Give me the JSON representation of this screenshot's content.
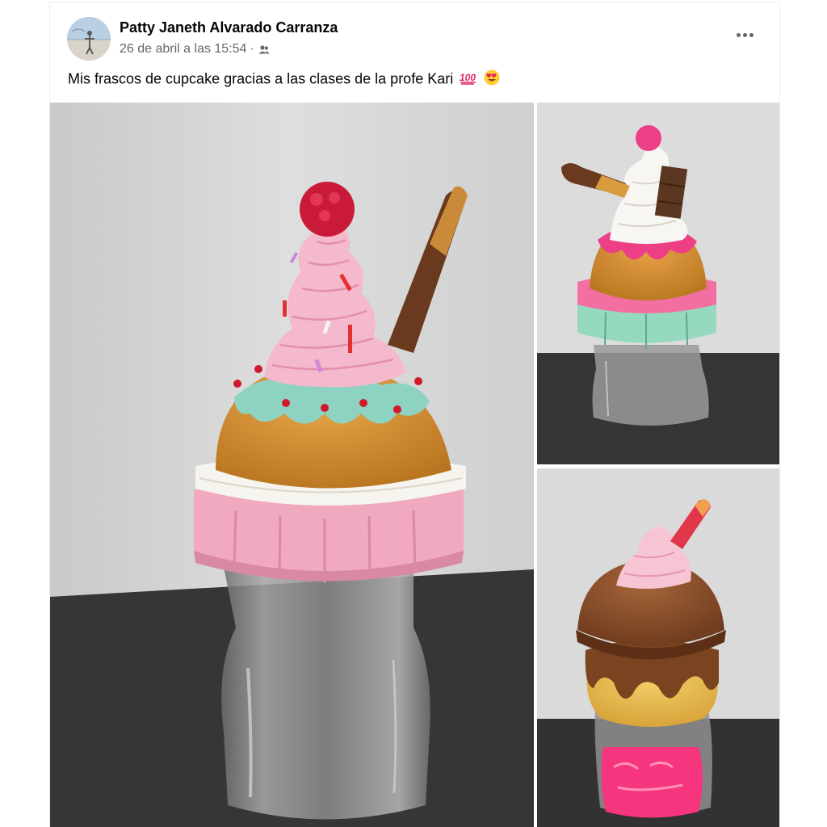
{
  "post": {
    "author": "Patty Janeth Alvarado Carranza",
    "timestamp": "26 de abril a las 15:54",
    "separator": "·",
    "privacy_icon": "friends-icon",
    "more_icon": "more-options-icon",
    "caption": "Mis frascos de cupcake gracias a las clases de la profe Kari",
    "caption_emojis": [
      "hundred-points-emoji",
      "heart-eyes-emoji"
    ]
  },
  "photos": [
    {
      "subject": "pink cupcake jar with raspberry and chocolate stick"
    },
    {
      "subject": "white whipped cream cupcake jar with chocolate bar"
    },
    {
      "subject": "chocolate cupcake jar with pink label"
    }
  ],
  "colors": {
    "text_primary": "#050505",
    "text_secondary": "#65676b",
    "wall": "#d6d6d6",
    "table": "#3a3a3a"
  }
}
